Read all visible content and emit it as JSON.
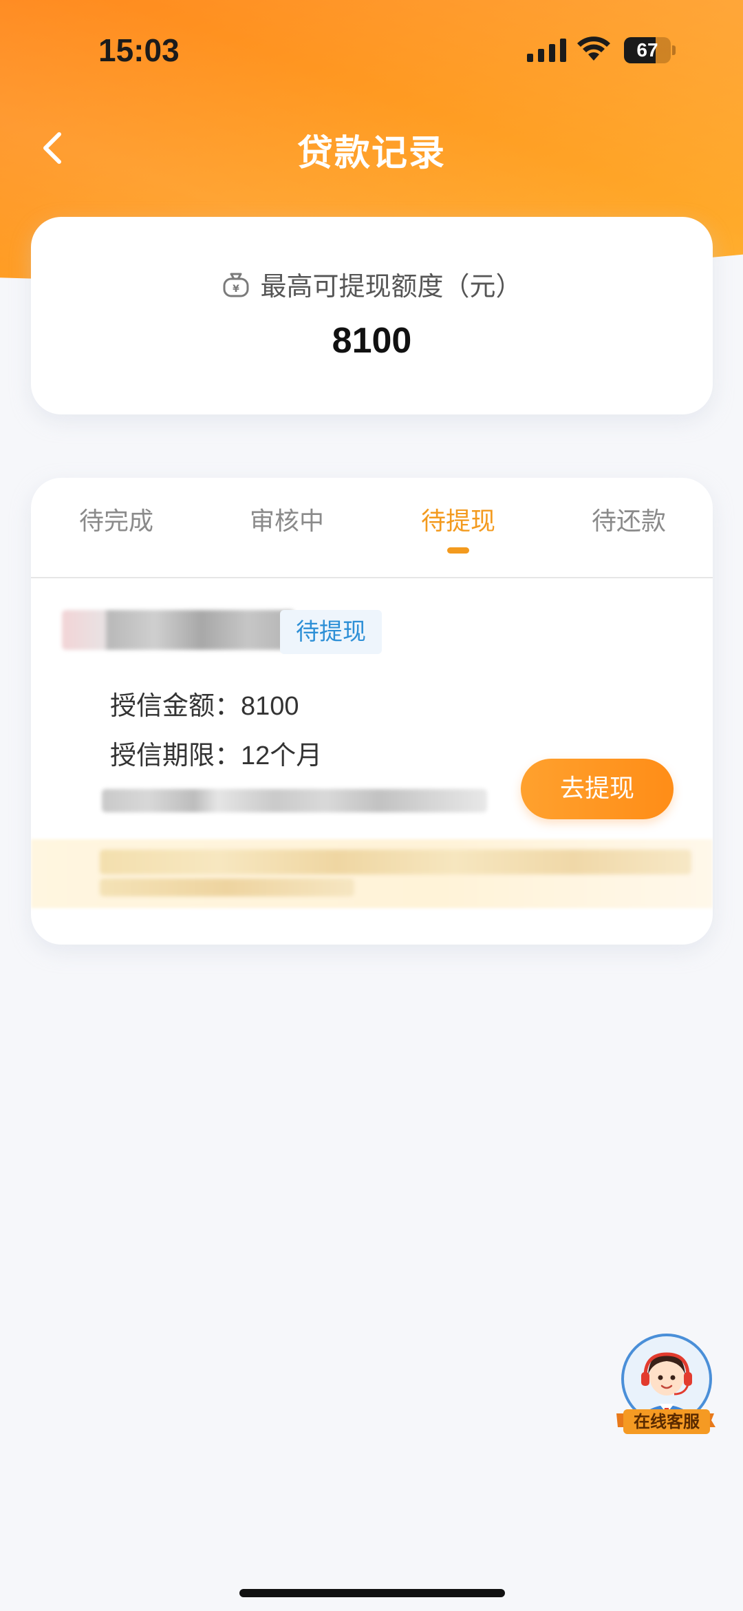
{
  "status_bar": {
    "time": "15:03",
    "battery": 67
  },
  "header": {
    "title": "贷款记录",
    "back_icon": "chevron-left-icon"
  },
  "quota_card": {
    "icon": "money-bag-icon",
    "label": "最高可提现额度（元）",
    "value": "8100"
  },
  "tabs": [
    {
      "label": "待完成",
      "active": false
    },
    {
      "label": "审核中",
      "active": false
    },
    {
      "label": "待提现",
      "active": true
    },
    {
      "label": "待还款",
      "active": false
    }
  ],
  "loan_record": {
    "status_tag": "待提现",
    "credit_amount_label": "授信金额：",
    "credit_amount_value": "8100",
    "credit_term_label": "授信期限：",
    "credit_term_value": "12个月",
    "action_button": "去提现"
  },
  "customer_service": {
    "label": "在线客服"
  },
  "colors": {
    "accent": "#f39a1e",
    "header_gradient_start": "#ff8a1f",
    "header_gradient_end": "#ffae2c",
    "tag_text": "#2d8fd6",
    "tag_bg": "#eef5fc"
  }
}
